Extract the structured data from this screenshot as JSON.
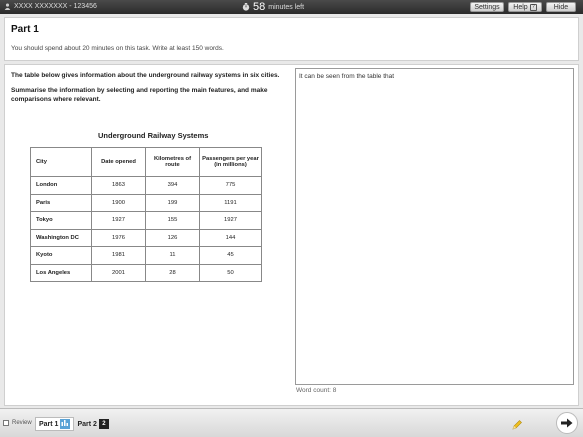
{
  "topbar": {
    "candidate": "XXXX XXXXXXX - 123456",
    "minutes": "58",
    "minutes_suffix": "minutes left",
    "settings_label": "Settings",
    "help_label": "Help",
    "help_badge": "?",
    "hide_label": "Hide"
  },
  "header": {
    "title": "Part 1",
    "instruction": "You should spend about 20 minutes on this task. Write at least 150 words."
  },
  "task": {
    "paragraph1": "The table below gives information about the underground railway systems in six cities.",
    "paragraph2": "Summarise the information by selecting and reporting the main features, and make comparisons where relevant.",
    "table_title": "Underground Railway Systems",
    "columns": [
      "City",
      "Date opened",
      "Kilometres of route",
      "Passengers per year (in millions)"
    ],
    "rows": [
      [
        "London",
        "1863",
        "394",
        "775"
      ],
      [
        "Paris",
        "1900",
        "199",
        "1191"
      ],
      [
        "Tokyo",
        "1927",
        "155",
        "1927"
      ],
      [
        "Washington DC",
        "1976",
        "126",
        "144"
      ],
      [
        "Kyoto",
        "1981",
        "11",
        "45"
      ],
      [
        "Los Angeles",
        "2001",
        "28",
        "50"
      ]
    ]
  },
  "answer": {
    "text": "It can be seen from the table that",
    "word_count_label": "Word count: 8"
  },
  "bottombar": {
    "review_label": "Review",
    "part1_label": "Part 1",
    "part1_badge": "",
    "part2_label": "Part 2",
    "part2_badge": "2"
  },
  "colors": {
    "topbar": "#2b2b2b",
    "part1_badge": "#5aa3d6",
    "part2_badge": "#222222",
    "pencil": "#f0c020"
  }
}
